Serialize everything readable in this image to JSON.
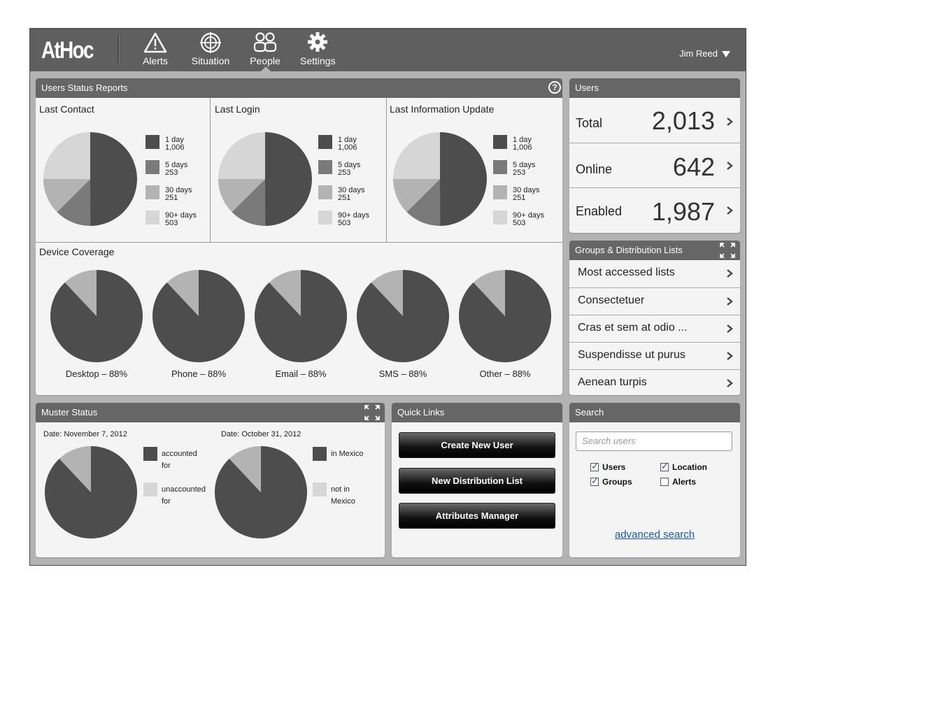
{
  "app": {
    "logo": "AtHoc"
  },
  "nav": {
    "items": [
      {
        "label": "Alerts",
        "icon": "alert-triangle-icon"
      },
      {
        "label": "Situation",
        "icon": "crosshair-globe-icon"
      },
      {
        "label": "People",
        "icon": "people-icon"
      },
      {
        "label": "Settings",
        "icon": "gear-icon"
      }
    ],
    "active": "People",
    "user": "Jim Reed"
  },
  "status_reports": {
    "title": "Users Status Reports",
    "help": "?",
    "charts": [
      {
        "title": "Last Contact",
        "legend": [
          {
            "label": "1 day",
            "value": "1,006"
          },
          {
            "label": "5 days",
            "value": "253"
          },
          {
            "label": "30 days",
            "value": "251"
          },
          {
            "label": "90+ days",
            "value": "503"
          }
        ]
      },
      {
        "title": "Last Login",
        "legend": [
          {
            "label": "1 day",
            "value": "1,006"
          },
          {
            "label": "5 days",
            "value": "253"
          },
          {
            "label": "30 days",
            "value": "251"
          },
          {
            "label": "90+ days",
            "value": "503"
          }
        ]
      },
      {
        "title": "Last Information Update",
        "legend": [
          {
            "label": "1 day",
            "value": "1,006"
          },
          {
            "label": "5 days",
            "value": "253"
          },
          {
            "label": "30 days",
            "value": "251"
          },
          {
            "label": "90+ days",
            "value": "503"
          }
        ]
      }
    ],
    "slice_colors": [
      "#4d4d4d",
      "#7a7a7a",
      "#b3b3b3",
      "#d6d6d6"
    ],
    "slice_values": [
      1006,
      253,
      251,
      503
    ],
    "device_coverage": {
      "title": "Device Coverage",
      "percent": 88,
      "items": [
        "Desktop – 88%",
        "Phone – 88%",
        "Email – 88%",
        "SMS – 88%",
        "Other – 88%"
      ]
    }
  },
  "users": {
    "title": "Users",
    "rows": [
      {
        "label": "Total",
        "value": "2,013"
      },
      {
        "label": "Online",
        "value": "642"
      },
      {
        "label": "Enabled",
        "value": "1,987"
      }
    ]
  },
  "groups": {
    "title": "Groups & Distribution Lists",
    "items": [
      "Most accessed lists",
      "Consectetuer",
      "Cras et sem at odio ...",
      "Suspendisse ut purus",
      "Aenean turpis"
    ]
  },
  "muster": {
    "title": "Muster Status",
    "charts": [
      {
        "date": "Date: November 7, 2012",
        "legend": [
          "accounted",
          "for",
          "unaccounted",
          "for"
        ],
        "percent": 88
      },
      {
        "date": "Date: October 31, 2012",
        "legend": [
          "in Mexico",
          "",
          "not in",
          "Mexico"
        ],
        "percent": 88
      }
    ]
  },
  "quick_links": {
    "title": "Quick Links",
    "buttons": [
      "Create New User",
      "New Distribution List",
      "Attributes Manager"
    ]
  },
  "search": {
    "title": "Search",
    "placeholder": "Search users",
    "options": [
      {
        "label": "Users",
        "checked": true
      },
      {
        "label": "Location",
        "checked": true
      },
      {
        "label": "Groups",
        "checked": true
      },
      {
        "label": "Alerts",
        "checked": false
      }
    ],
    "advanced": "advanced search"
  }
}
